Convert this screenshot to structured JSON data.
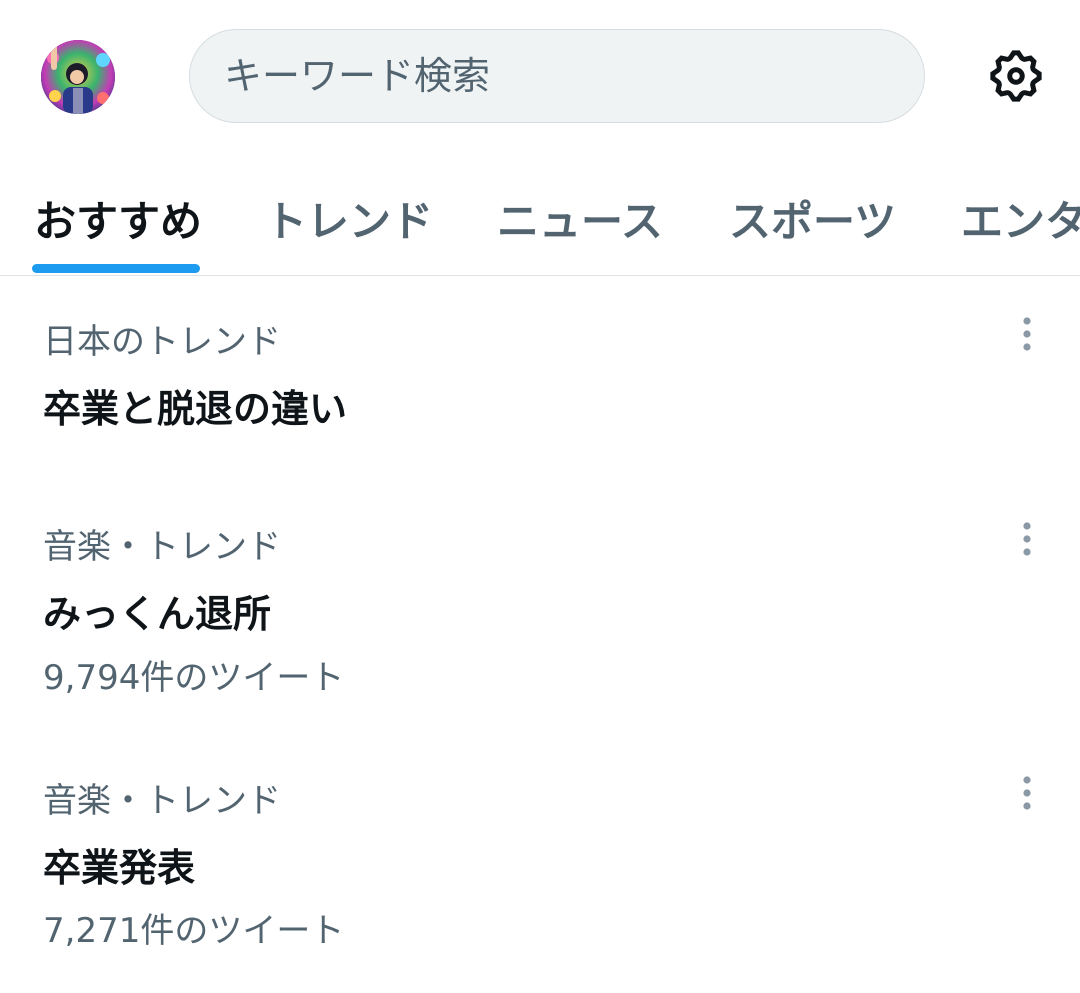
{
  "search": {
    "placeholder": "キーワード検索"
  },
  "header": {
    "avatar_icon": "profile-avatar",
    "settings_icon": "gear-icon"
  },
  "tabs": [
    {
      "label": "おすすめ",
      "active": true
    },
    {
      "label": "トレンド",
      "active": false
    },
    {
      "label": "ニュース",
      "active": false
    },
    {
      "label": "スポーツ",
      "active": false
    },
    {
      "label": "エンタ",
      "active": false
    }
  ],
  "trends": [
    {
      "category": "日本のトレンド",
      "title": "卒業と脱退の違い",
      "count": ""
    },
    {
      "category": "音楽・トレンド",
      "title": "みっくん退所",
      "count": "9,794件のツイート"
    },
    {
      "category": "音楽・トレンド",
      "title": "卒業発表",
      "count": "7,271件のツイート"
    }
  ],
  "colors": {
    "accent": "#1d9bf0",
    "text_primary": "#0f1419",
    "text_secondary": "#536471",
    "search_bg": "#eff3f4"
  }
}
